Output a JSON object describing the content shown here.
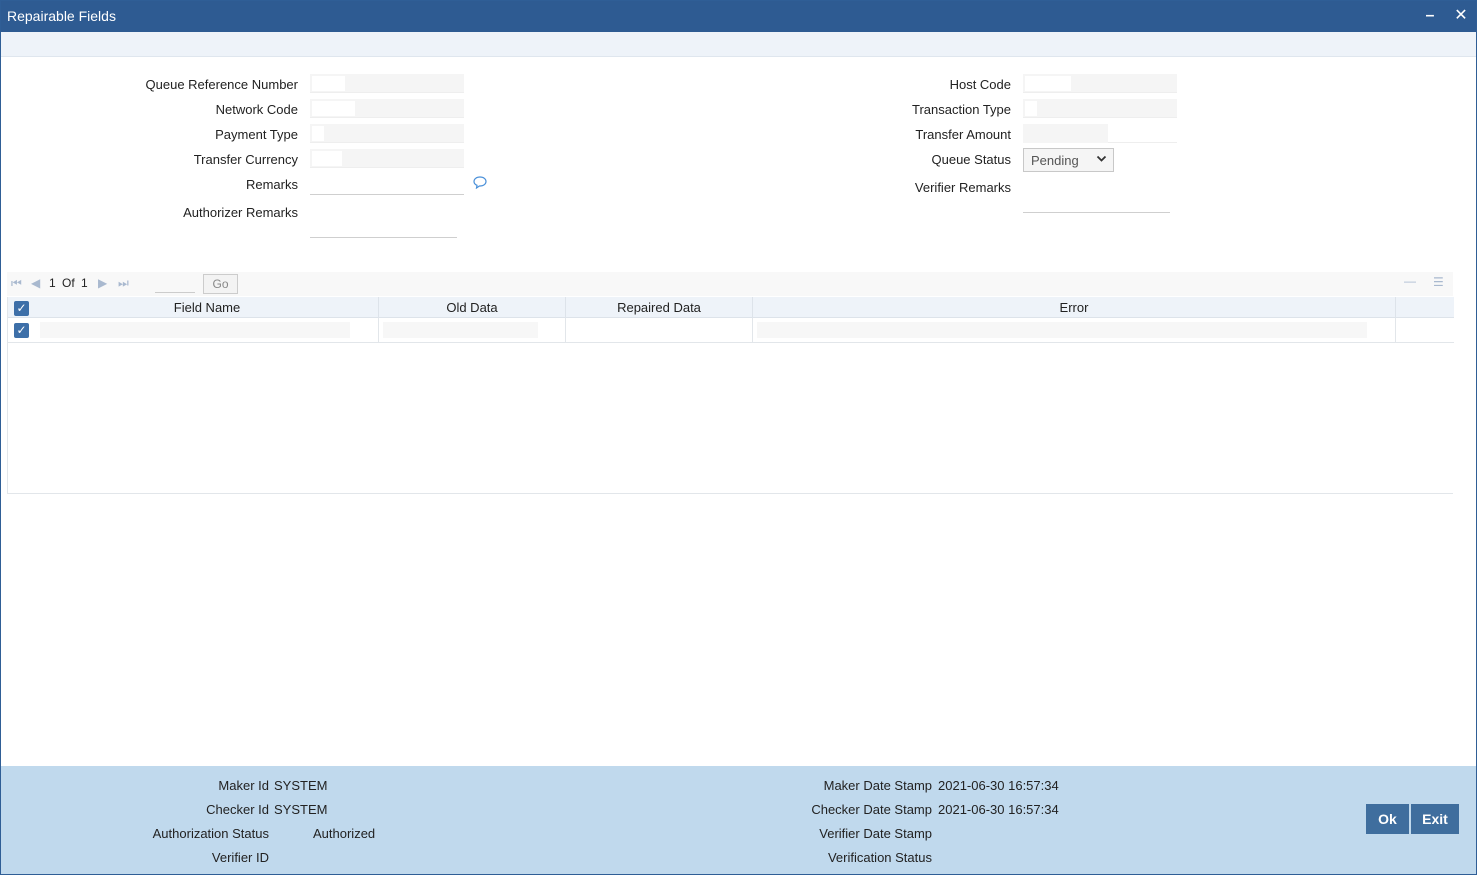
{
  "window": {
    "title": "Repairable Fields",
    "minimize_icon": "minimize-icon",
    "close_icon": "close-icon"
  },
  "form": {
    "queue_reference_number": {
      "label": "Queue Reference Number",
      "value": ""
    },
    "network_code": {
      "label": "Network Code",
      "value": ""
    },
    "payment_type": {
      "label": "Payment Type",
      "value": ""
    },
    "transfer_currency": {
      "label": "Transfer Currency",
      "value": ""
    },
    "remarks": {
      "label": "Remarks",
      "value": ""
    },
    "authorizer_remarks": {
      "label": "Authorizer Remarks",
      "value": ""
    },
    "host_code": {
      "label": "Host Code",
      "value": ""
    },
    "transaction_type": {
      "label": "Transaction Type",
      "value": ""
    },
    "transfer_amount": {
      "label": "Transfer Amount",
      "value": ""
    },
    "queue_status": {
      "label": "Queue Status",
      "value": "Pending"
    },
    "verifier_remarks": {
      "label": "Verifier Remarks",
      "value": ""
    }
  },
  "pager": {
    "current": "1",
    "of_label": "Of",
    "total": "1",
    "go_label": "Go"
  },
  "grid": {
    "columns": [
      "Field Name",
      "Old Data",
      "Repaired Data",
      "Error"
    ],
    "rows": [
      {
        "checked": true,
        "cells": [
          "",
          "",
          "",
          ""
        ]
      }
    ]
  },
  "footer": {
    "maker_id": {
      "label": "Maker Id",
      "value": "SYSTEM"
    },
    "checker_id": {
      "label": "Checker Id",
      "value": "SYSTEM"
    },
    "authorization_status": {
      "label": "Authorization Status",
      "value": "Authorized"
    },
    "verifier_id": {
      "label": "Verifier ID",
      "value": ""
    },
    "maker_date_stamp": {
      "label": "Maker Date Stamp",
      "value": "2021-06-30 16:57:34"
    },
    "checker_date_stamp": {
      "label": "Checker Date Stamp",
      "value": "2021-06-30 16:57:34"
    },
    "verifier_date_stamp": {
      "label": "Verifier Date Stamp",
      "value": ""
    },
    "verification_status": {
      "label": "Verification Status",
      "value": ""
    }
  },
  "buttons": {
    "ok": "Ok",
    "exit": "Exit"
  },
  "colors": {
    "title_bar": "#2e5b92",
    "footer": "#c0d9ed",
    "button": "#3f6e9e"
  }
}
